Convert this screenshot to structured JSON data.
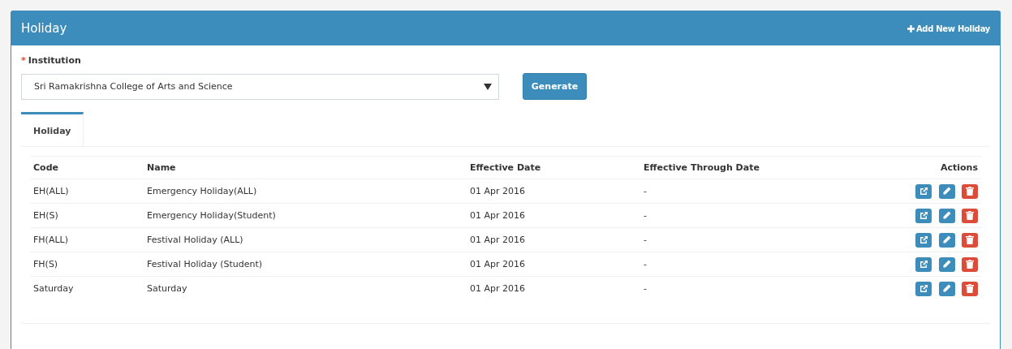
{
  "panel": {
    "title": "Holiday",
    "add_link": "Add New Holiday"
  },
  "institution": {
    "required_mark": "*",
    "label": "Institution",
    "value": "Sri Ramakrishna College of Arts and Science"
  },
  "generate_button": "Generate",
  "tabs": [
    {
      "label": "Holiday",
      "selected": true
    }
  ],
  "table": {
    "columns": [
      "Code",
      "Name",
      "Effective Date",
      "Effective Through Date",
      "Actions"
    ],
    "rows": [
      {
        "code": "EH(ALL)",
        "name": "Emergency Holiday(ALL)",
        "effective_date": "01 Apr 2016",
        "through_date": "-"
      },
      {
        "code": "EH(S)",
        "name": "Emergency Holiday(Student)",
        "effective_date": "01 Apr 2016",
        "through_date": "-"
      },
      {
        "code": "FH(ALL)",
        "name": "Festival Holiday (ALL)",
        "effective_date": "01 Apr 2016",
        "through_date": "-"
      },
      {
        "code": "FH(S)",
        "name": "Festival Holiday (Student)",
        "effective_date": "01 Apr 2016",
        "through_date": "-"
      },
      {
        "code": "Saturday",
        "name": "Saturday",
        "effective_date": "01 Apr 2016",
        "through_date": "-"
      }
    ]
  }
}
